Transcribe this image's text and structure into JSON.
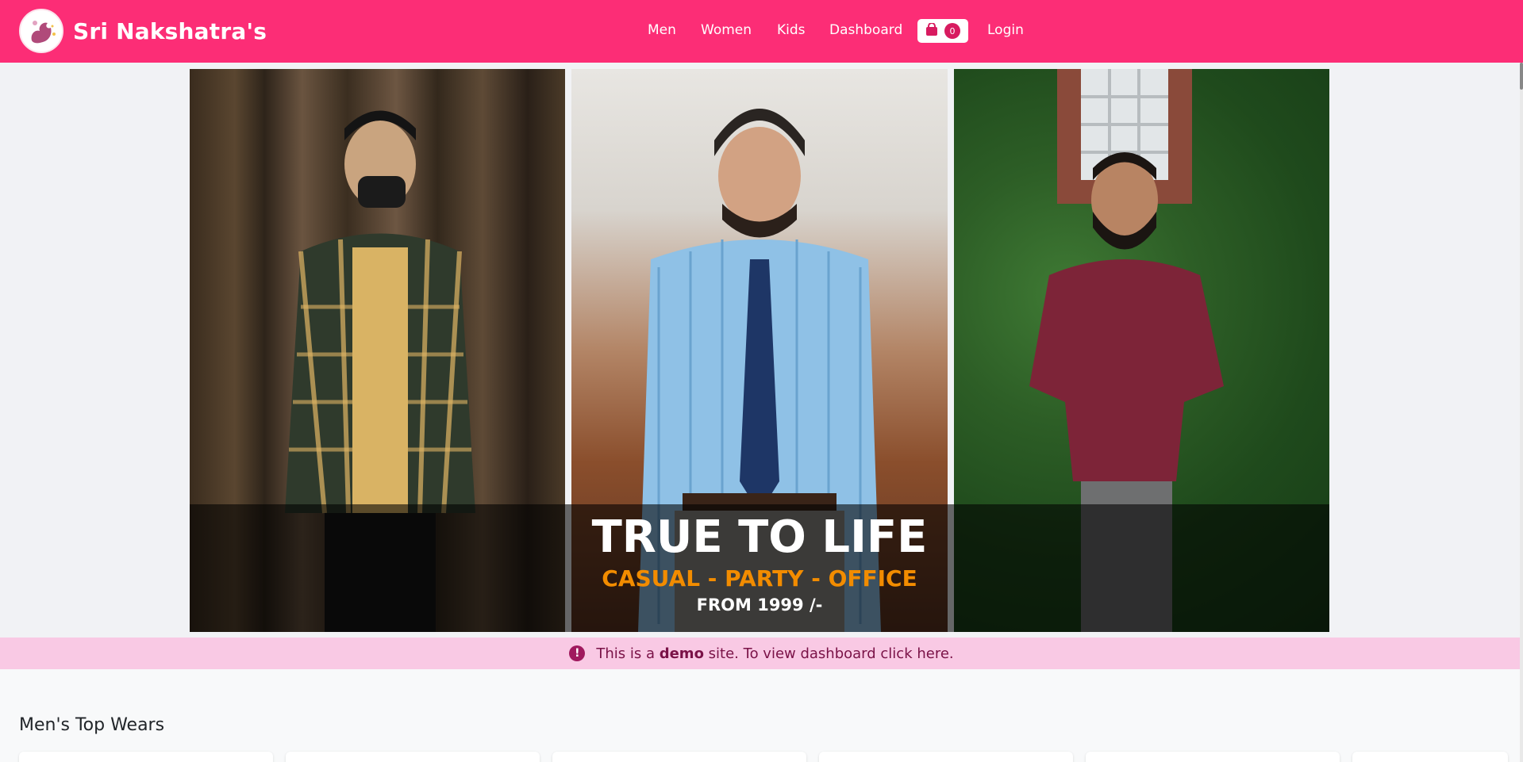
{
  "brand": {
    "name": "Sri Nakshatra's"
  },
  "nav": {
    "items": [
      "Men",
      "Women",
      "Kids",
      "Dashboard"
    ],
    "cart_count": "0",
    "login": "Login"
  },
  "hero": {
    "title": "TRUE TO LIFE",
    "subtitle": "CASUAL - PARTY - OFFICE",
    "price": "FROM 1999 /-"
  },
  "alert": {
    "prefix": "This is a",
    "bold": "demo",
    "suffix": "site. To view dashboard click here."
  },
  "section": {
    "title": "Men's Top Wears"
  },
  "colors": {
    "navbar": "#fc2d76",
    "alert_bg": "#f9c9e4",
    "alert_text": "#7a1247",
    "hero_subtitle": "#f28c00"
  },
  "icons": {
    "cart": "shopping-bag-icon",
    "alert": "exclamation-circle-icon"
  }
}
